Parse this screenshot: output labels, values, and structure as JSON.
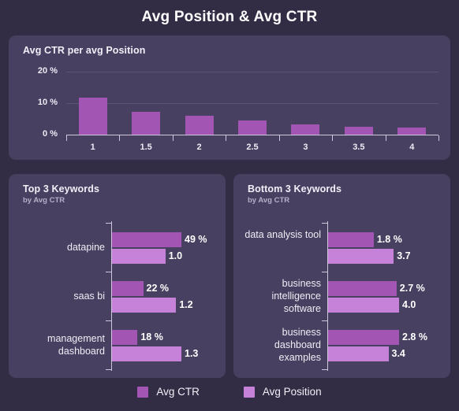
{
  "header": {
    "title": "Avg Position & Avg CTR"
  },
  "colors": {
    "page_background": "#322c44",
    "panel_background": "#474060",
    "avg_ctr": "#a355b4",
    "avg_position": "#c681d9",
    "axis": "#cfc7de",
    "gridline": "#5b5375",
    "text": "#ffffff"
  },
  "top_panel": {
    "title": "Avg CTR per avg Position"
  },
  "left_panel": {
    "title": "Top 3 Keywords",
    "subtitle": "by Avg CTR"
  },
  "right_panel": {
    "title": "Bottom 3 Keywords",
    "subtitle": "by Avg CTR"
  },
  "legend": {
    "items": [
      {
        "label": "Avg CTR",
        "color": "#a355b4"
      },
      {
        "label": "Avg Position",
        "color": "#c681d9"
      }
    ]
  },
  "chart_data": [
    {
      "id": "avg-ctr-per-avg-position",
      "type": "bar",
      "title": "Avg CTR per avg Position",
      "xlabel": "",
      "ylabel": "",
      "categories": [
        "1",
        "1.5",
        "2",
        "2.5",
        "3",
        "3.5",
        "4"
      ],
      "values": [
        11.8,
        7.3,
        6.1,
        4.4,
        3.3,
        2.6,
        2.3
      ],
      "value_suffix": " %",
      "ylim": [
        0,
        20
      ],
      "yticks": [
        0,
        10,
        20
      ],
      "ytick_labels": [
        "0 %",
        "10 %",
        "20 %"
      ],
      "grid": true,
      "legend": "bottom",
      "series_name": "Avg CTR",
      "color": "#a355b4"
    },
    {
      "id": "top-3-keywords",
      "type": "bar",
      "orientation": "horizontal",
      "title": "Top 3 Keywords",
      "subtitle": "by Avg CTR",
      "categories": [
        "datapine",
        "saas bi",
        "management dashboard"
      ],
      "series": [
        {
          "name": "Avg CTR",
          "color": "#a355b4",
          "values": [
            49,
            22,
            18
          ],
          "labels": [
            "49 %",
            "22 %",
            "18 %"
          ]
        },
        {
          "name": "Avg Position",
          "color": "#c681d9",
          "values": [
            1.0,
            1.2,
            1.3
          ],
          "labels": [
            "1.0",
            "1.2",
            "1.3"
          ]
        }
      ]
    },
    {
      "id": "bottom-3-keywords",
      "type": "bar",
      "orientation": "horizontal",
      "title": "Bottom 3 Keywords",
      "subtitle": "by Avg CTR",
      "categories": [
        "data analysis tool",
        "business intelligence software",
        "business dashboard examples"
      ],
      "series": [
        {
          "name": "Avg CTR",
          "color": "#a355b4",
          "values": [
            1.8,
            2.7,
            2.8
          ],
          "labels": [
            "1.8 %",
            "2.7 %",
            "2.8 %"
          ]
        },
        {
          "name": "Avg Position",
          "color": "#c681d9",
          "values": [
            3.7,
            4.0,
            3.4
          ],
          "labels": [
            "3.7",
            "4.0",
            "3.4"
          ]
        }
      ]
    }
  ]
}
